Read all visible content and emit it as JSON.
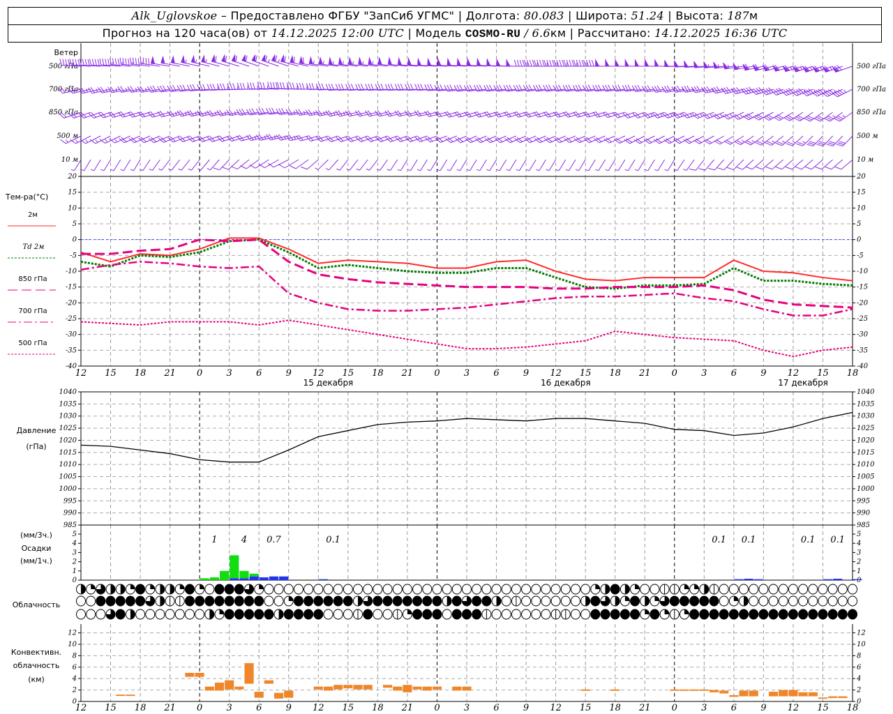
{
  "header": {
    "station": "Alk_Uglovskoe",
    "provider": " – Предоставлено ФГБУ \"ЗапСиб УГМС\" | Долгота: ",
    "lon": "80.083",
    "lat_label": " | Широта: ",
    "lat": "51.24",
    "alt_label": " | Высота: ",
    "alt": "187",
    "alt_unit": "м",
    "forecast_label": "Прогноз на 120 часа(ов) от ",
    "forecast_start": "14.12.2025 12:00 UTC",
    "model_label": "  | Модель ",
    "model": "COSMO-RU",
    "res": " / 6.6",
    "res_unit": "км",
    "calc_label": " | Рассчитано: ",
    "calc_time": "14.12.2025 16:36 UTC"
  },
  "colors": {
    "wind": "#8a2be2",
    "t2m": "#ff2a2a",
    "td2m": "#007a00",
    "upper": "#e6007e",
    "zero": "#3344ff",
    "rain": "#11dd11",
    "snow": "#2233ee",
    "conv": "#f0862a"
  },
  "wind": {
    "title": "Ветер",
    "levels": [
      {
        "label": "500 гПа",
        "dir": [
          275,
          275,
          280,
          285,
          290,
          295,
          300,
          300,
          285,
          280,
          280,
          280,
          275,
          275,
          275,
          270,
          270,
          270,
          270,
          270,
          270,
          265,
          260,
          250,
          245,
          240,
          240
        ],
        "speed": [
          20,
          22,
          24,
          25,
          28,
          30,
          32,
          33,
          30,
          28,
          28,
          27,
          26,
          26,
          25,
          25,
          24,
          24,
          25,
          25,
          26,
          27,
          28,
          30,
          32,
          34,
          35
        ]
      },
      {
        "label": "700 гПа",
        "dir": [
          250,
          250,
          255,
          255,
          260,
          265,
          270,
          275,
          270,
          265,
          265,
          265,
          265,
          260,
          260,
          260,
          260,
          260,
          260,
          260,
          255,
          255,
          250,
          245,
          240,
          235,
          230
        ],
        "speed": [
          12,
          13,
          14,
          15,
          16,
          18,
          18,
          20,
          18,
          17,
          16,
          16,
          15,
          15,
          15,
          15,
          15,
          15,
          16,
          16,
          17,
          18,
          19,
          20,
          22,
          23,
          24
        ]
      },
      {
        "label": "850 гПа",
        "dir": [
          240,
          240,
          245,
          245,
          250,
          250,
          255,
          260,
          255,
          250,
          250,
          250,
          250,
          245,
          245,
          245,
          245,
          245,
          245,
          240,
          240,
          240,
          235,
          230,
          225,
          220,
          220
        ],
        "speed": [
          10,
          11,
          12,
          12,
          13,
          14,
          15,
          16,
          14,
          13,
          12,
          12,
          12,
          12,
          12,
          12,
          12,
          12,
          12,
          12,
          13,
          13,
          14,
          15,
          16,
          17,
          18
        ]
      },
      {
        "label": "500 м",
        "dir": [
          230,
          230,
          235,
          235,
          240,
          240,
          245,
          250,
          245,
          240,
          240,
          240,
          240,
          235,
          235,
          235,
          235,
          235,
          235,
          230,
          230,
          230,
          225,
          220,
          215,
          210,
          210
        ],
        "speed": [
          8,
          9,
          10,
          10,
          11,
          12,
          12,
          14,
          12,
          11,
          10,
          10,
          10,
          10,
          10,
          10,
          10,
          10,
          10,
          10,
          11,
          11,
          12,
          13,
          14,
          15,
          16
        ]
      },
      {
        "label": "10 м",
        "dir": [
          200,
          200,
          200,
          205,
          205,
          210,
          220,
          230,
          215,
          205,
          205,
          200,
          200,
          200,
          200,
          200,
          200,
          200,
          200,
          200,
          200,
          205,
          210,
          215,
          215,
          215,
          215
        ],
        "speed": [
          4,
          4,
          4,
          4,
          4,
          5,
          6,
          7,
          5,
          4,
          4,
          4,
          4,
          4,
          4,
          4,
          4,
          4,
          4,
          4,
          4,
          5,
          6,
          6,
          6,
          6,
          6
        ]
      }
    ]
  },
  "axis": {
    "hour_labels": [
      "12",
      "15",
      "18",
      "21",
      "0",
      "3",
      "6",
      "9",
      "12",
      "15",
      "18",
      "21",
      "0",
      "3",
      "6",
      "9",
      "12",
      "15",
      "18",
      "21",
      "0",
      "3",
      "6",
      "9",
      "12",
      "15",
      "18"
    ],
    "dates": [
      {
        "label": "15 декабря",
        "hour": 25
      },
      {
        "label": "16 декабря",
        "hour": 49
      },
      {
        "label": "17 декабря",
        "hour": 73
      }
    ]
  },
  "temperature": {
    "title": "Тем-ра(°С)",
    "range": [
      -40,
      20
    ],
    "ticks": [
      "20",
      "15",
      "10",
      "5",
      "0",
      "-5",
      "-10",
      "-15",
      "-20",
      "-25",
      "-30",
      "-35",
      "-40"
    ],
    "legend": [
      {
        "label": "2м",
        "key": "t2m"
      },
      {
        "label": "Td  2м",
        "key": "td2m"
      },
      {
        "label": "850 гПа",
        "key": "t850"
      },
      {
        "label": "700 гПа",
        "key": "t700"
      },
      {
        "label": "500 гПа",
        "key": "t500"
      }
    ],
    "hours_step": 3,
    "t2m": [
      -4,
      -7,
      -4.5,
      -5,
      -3,
      0.5,
      0.5,
      -3,
      -7.5,
      -6.5,
      -7,
      -7.5,
      -9,
      -9,
      -7,
      -6.5,
      -10,
      -12.5,
      -13,
      -12,
      -12,
      -12,
      -6.5,
      -10,
      -10.5,
      -12,
      -13
    ],
    "td2m": [
      -7,
      -8.5,
      -5,
      -5.5,
      -4,
      -0.5,
      0,
      -4,
      -9,
      -8,
      -9,
      -10,
      -10.5,
      -10.5,
      -9,
      -9,
      -12,
      -15,
      -15.5,
      -14.5,
      -14.5,
      -14,
      -9,
      -13,
      -13,
      -14,
      -14.5
    ],
    "t850": [
      -4.5,
      -4.5,
      -3.5,
      -3,
      0,
      -0.5,
      0,
      -7,
      -11,
      -12.5,
      -13.5,
      -14,
      -14.5,
      -15,
      -15,
      -15,
      -15.5,
      -15.5,
      -15,
      -15,
      -15,
      -14.5,
      -16,
      -19,
      -20.5,
      -21,
      -21.5
    ],
    "t700": [
      -9.5,
      -8,
      -7,
      -7.5,
      -8.5,
      -9,
      -8.5,
      -17,
      -20,
      -22,
      -22.5,
      -22.5,
      -22,
      -21.5,
      -20.5,
      -19.5,
      -18.5,
      -18,
      -18,
      -17.5,
      -17,
      -18.5,
      -19.5,
      -22,
      -24,
      -24,
      -22
    ],
    "t500": [
      -26,
      -26.5,
      -27,
      -26,
      -26,
      -26,
      -27,
      -25.5,
      -27,
      -28.5,
      -30,
      -31.5,
      -33,
      -34.5,
      -34.5,
      -34,
      -33,
      -32,
      -29,
      -30,
      -31,
      -31.5,
      -32,
      -35,
      -37,
      -35,
      -34
    ]
  },
  "pressure": {
    "title": "Давление",
    "unit": "(гПа)",
    "range": [
      985,
      1040
    ],
    "ticks": [
      "1040",
      "1035",
      "1030",
      "1025",
      "1020",
      "1015",
      "1010",
      "1005",
      "1000",
      "995",
      "990",
      "985"
    ],
    "values": [
      1018,
      1017.5,
      1016,
      1014.5,
      1012,
      1011,
      1011,
      1016,
      1021.5,
      1024,
      1026.5,
      1027.5,
      1028,
      1029,
      1028.5,
      1028,
      1029,
      1029,
      1028,
      1027,
      1024.5,
      1024,
      1022,
      1023,
      1025.5,
      1029,
      1031.5
    ]
  },
  "precip": {
    "label_top": "(мм/3ч.)",
    "title": "Осадки",
    "label_bottom": "(мм/1ч.)",
    "range": [
      0,
      5
    ],
    "ticks": [
      "5",
      "4",
      "3",
      "2",
      "1",
      "0"
    ],
    "hourly": [
      {
        "h": 12,
        "rain": 0.2,
        "snow": 0
      },
      {
        "h": 13,
        "rain": 0.3,
        "snow": 0
      },
      {
        "h": 14,
        "rain": 1.0,
        "snow": 0
      },
      {
        "h": 15,
        "rain": 2.5,
        "snow": 0.2
      },
      {
        "h": 16,
        "rain": 0.8,
        "snow": 0.2
      },
      {
        "h": 17,
        "rain": 0.3,
        "snow": 0.4
      },
      {
        "h": 18,
        "rain": 0,
        "snow": 0.3
      },
      {
        "h": 19,
        "rain": 0,
        "snow": 0.4
      },
      {
        "h": 20,
        "rain": 0,
        "snow": 0.4
      },
      {
        "h": 24,
        "rain": 0,
        "snow": 0.1
      },
      {
        "h": 66,
        "rain": 0,
        "snow": 0.1
      },
      {
        "h": 67,
        "rain": 0,
        "snow": 0.15
      },
      {
        "h": 68,
        "rain": 0,
        "snow": 0.1
      },
      {
        "h": 75,
        "rain": 0,
        "snow": 0.1
      },
      {
        "h": 76,
        "rain": 0,
        "snow": 0.15
      },
      {
        "h": 78,
        "rain": 0,
        "snow": 0.1
      }
    ],
    "sums3h": [
      {
        "h": 13.5,
        "label": "1"
      },
      {
        "h": 16.5,
        "label": "4"
      },
      {
        "h": 19.5,
        "label": "0.7"
      },
      {
        "h": 25.5,
        "label": "0.1"
      },
      {
        "h": 64.5,
        "label": "0.1"
      },
      {
        "h": 67.5,
        "label": "0.1"
      },
      {
        "h": 73.5,
        "label": "0.1"
      },
      {
        "h": 76.5,
        "label": "0.1"
      }
    ]
  },
  "clouds": {
    "title": "Облачность",
    "rows_octas": [
      "4264428244282088862000000000000000000000000000000000248420011224100000000000000",
      "0088888641188888888002888888468888888486884010000004864284268888802400000000000",
      "0006840000000428888848888000180012888088810000001100888882821288888888888888888"
    ]
  },
  "convective": {
    "title1": "Конвективн.",
    "title2": "облачность",
    "unit": "(км)",
    "ticks": [
      "12",
      "10",
      "8",
      "6",
      "4",
      "2",
      "0"
    ],
    "bars": [
      [
        4,
        1.0,
        1.2
      ],
      [
        5,
        1.0,
        1.2
      ],
      [
        11,
        4.3,
        5.0
      ],
      [
        12,
        4.3,
        5.0
      ],
      [
        13,
        1.9,
        2.6
      ],
      [
        14,
        1.9,
        3.3
      ],
      [
        15,
        2.1,
        3.7
      ],
      [
        16,
        2.1,
        2.6
      ],
      [
        17,
        3.1,
        6.7
      ],
      [
        18,
        0.65,
        1.7
      ],
      [
        19,
        3.1,
        3.7
      ],
      [
        20,
        0.5,
        1.5
      ],
      [
        21,
        0.65,
        1.9
      ],
      [
        24,
        2.1,
        2.6
      ],
      [
        25,
        1.9,
        2.6
      ],
      [
        26,
        2.1,
        2.9
      ],
      [
        27,
        2.3,
        2.9
      ],
      [
        28,
        2.1,
        2.9
      ],
      [
        29,
        2.1,
        2.9
      ],
      [
        31,
        2.4,
        2.9
      ],
      [
        32,
        1.9,
        2.6
      ],
      [
        33,
        1.6,
        2.9
      ],
      [
        34,
        2.1,
        2.6
      ],
      [
        35,
        1.9,
        2.6
      ],
      [
        36,
        2.1,
        2.6
      ],
      [
        38,
        1.9,
        2.6
      ],
      [
        39,
        1.9,
        2.6
      ],
      [
        51,
        1.9,
        2.1
      ],
      [
        54,
        1.9,
        2.1
      ],
      [
        60,
        1.9,
        2.1
      ],
      [
        61,
        1.9,
        2.1
      ],
      [
        62,
        1.9,
        2.1
      ],
      [
        63,
        1.9,
        2.1
      ],
      [
        64,
        1.6,
        2.0
      ],
      [
        65,
        1.4,
        1.9
      ],
      [
        66,
        0.8,
        1.1
      ],
      [
        67,
        0.9,
        1.9
      ],
      [
        68,
        0.9,
        1.9
      ],
      [
        70,
        0.9,
        1.7
      ],
      [
        71,
        0.9,
        2.0
      ],
      [
        72,
        0.9,
        2.0
      ],
      [
        73,
        0.9,
        1.6
      ],
      [
        74,
        0.9,
        1.6
      ],
      [
        75,
        0.5,
        0.7
      ],
      [
        76,
        0.6,
        0.9
      ],
      [
        77,
        0.6,
        0.9
      ]
    ]
  }
}
